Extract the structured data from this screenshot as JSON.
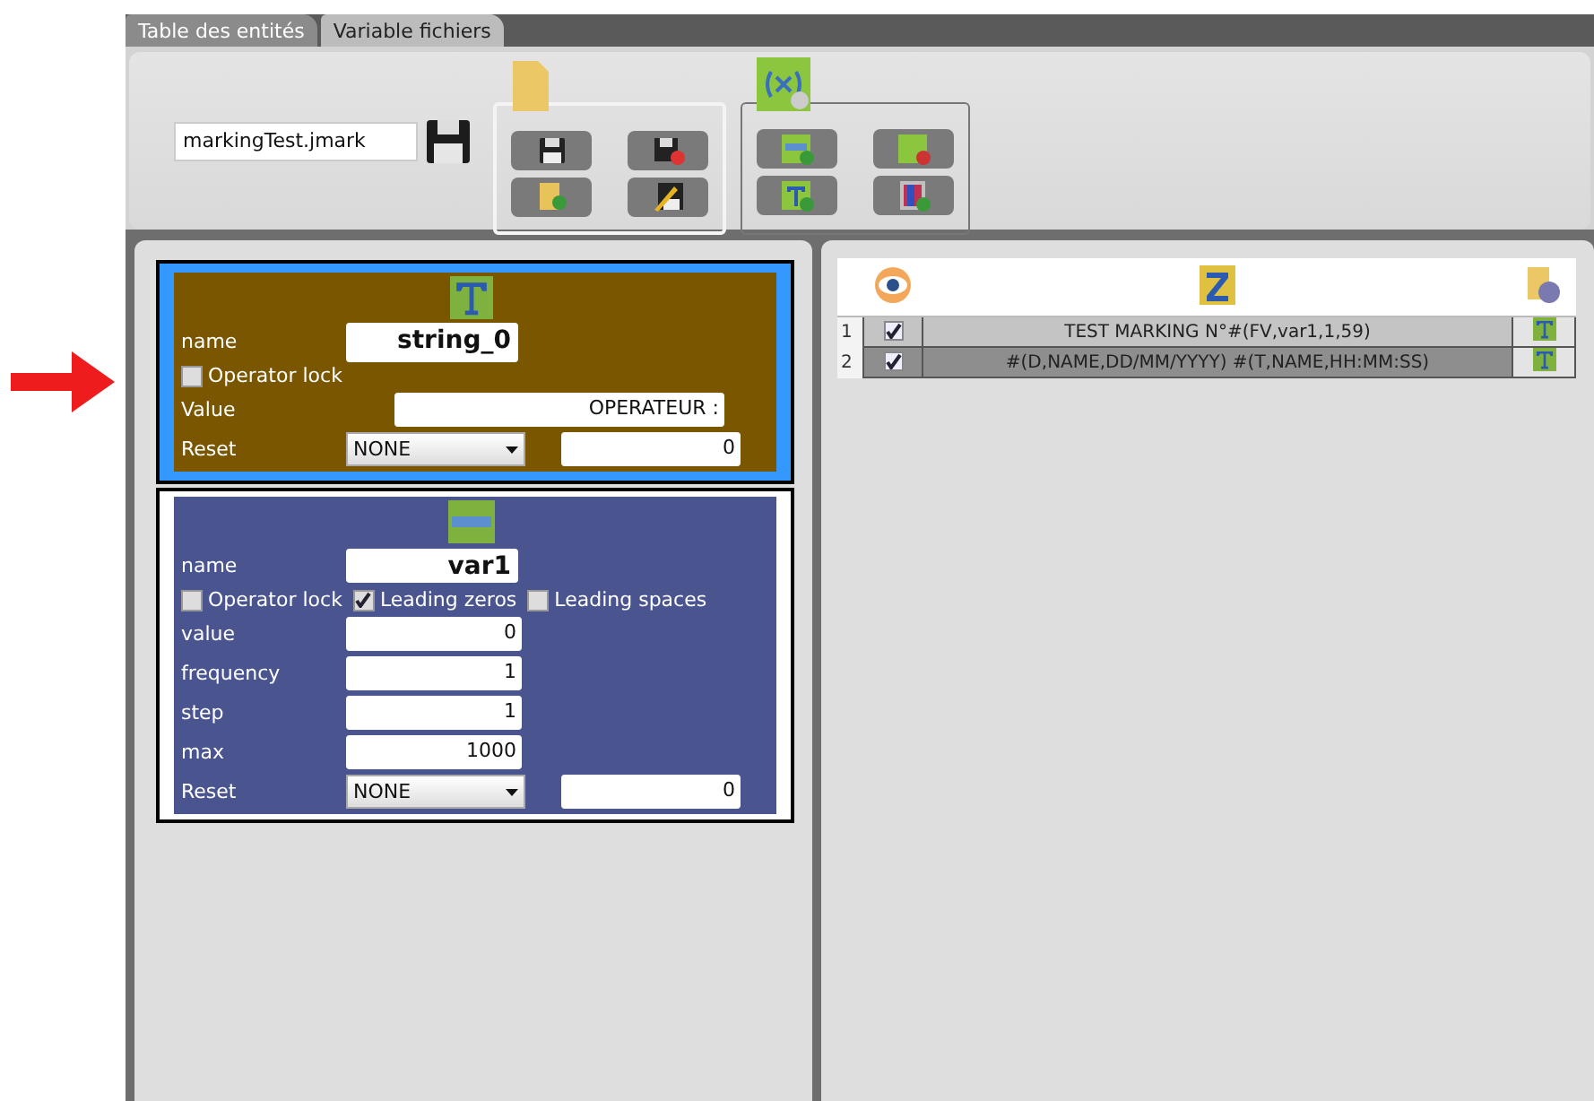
{
  "tabs": [
    {
      "label": "Table des entités",
      "selected": false
    },
    {
      "label": "Variable fichiers",
      "selected": true
    }
  ],
  "toolbar": {
    "filename": "markingTest.jmark"
  },
  "entities": [
    {
      "kind": "string",
      "selected": true,
      "name_label": "name",
      "name": "string_0",
      "checkboxes": [
        {
          "label": "Operator lock",
          "checked": false
        }
      ],
      "fields": [
        {
          "label": "Value",
          "value": "OPERATEUR :"
        }
      ],
      "reset": {
        "label": "Reset",
        "mode": "NONE",
        "value": "0"
      }
    },
    {
      "kind": "counter",
      "selected": false,
      "name_label": "name",
      "name": "var1",
      "checkboxes": [
        {
          "label": "Operator lock",
          "checked": false
        },
        {
          "label": "Leading zeros",
          "checked": true
        },
        {
          "label": "Leading spaces",
          "checked": false
        }
      ],
      "fields": [
        {
          "label": "value",
          "value": "0"
        },
        {
          "label": "frequency",
          "value": "1"
        },
        {
          "label": "step",
          "value": "1"
        },
        {
          "label": "max",
          "value": "1000"
        }
      ],
      "reset": {
        "label": "Reset",
        "mode": "NONE",
        "value": "0"
      }
    }
  ],
  "grid": {
    "rows": [
      {
        "number": "1",
        "visible": true,
        "text": "TEST MARKING N°#(FV,var1,1,59)",
        "selected": false
      },
      {
        "number": "2",
        "visible": true,
        "text": "#(D,NAME,DD/MM/YYYY)  #(T,NAME,HH:MM:SS)",
        "selected": true
      }
    ]
  }
}
